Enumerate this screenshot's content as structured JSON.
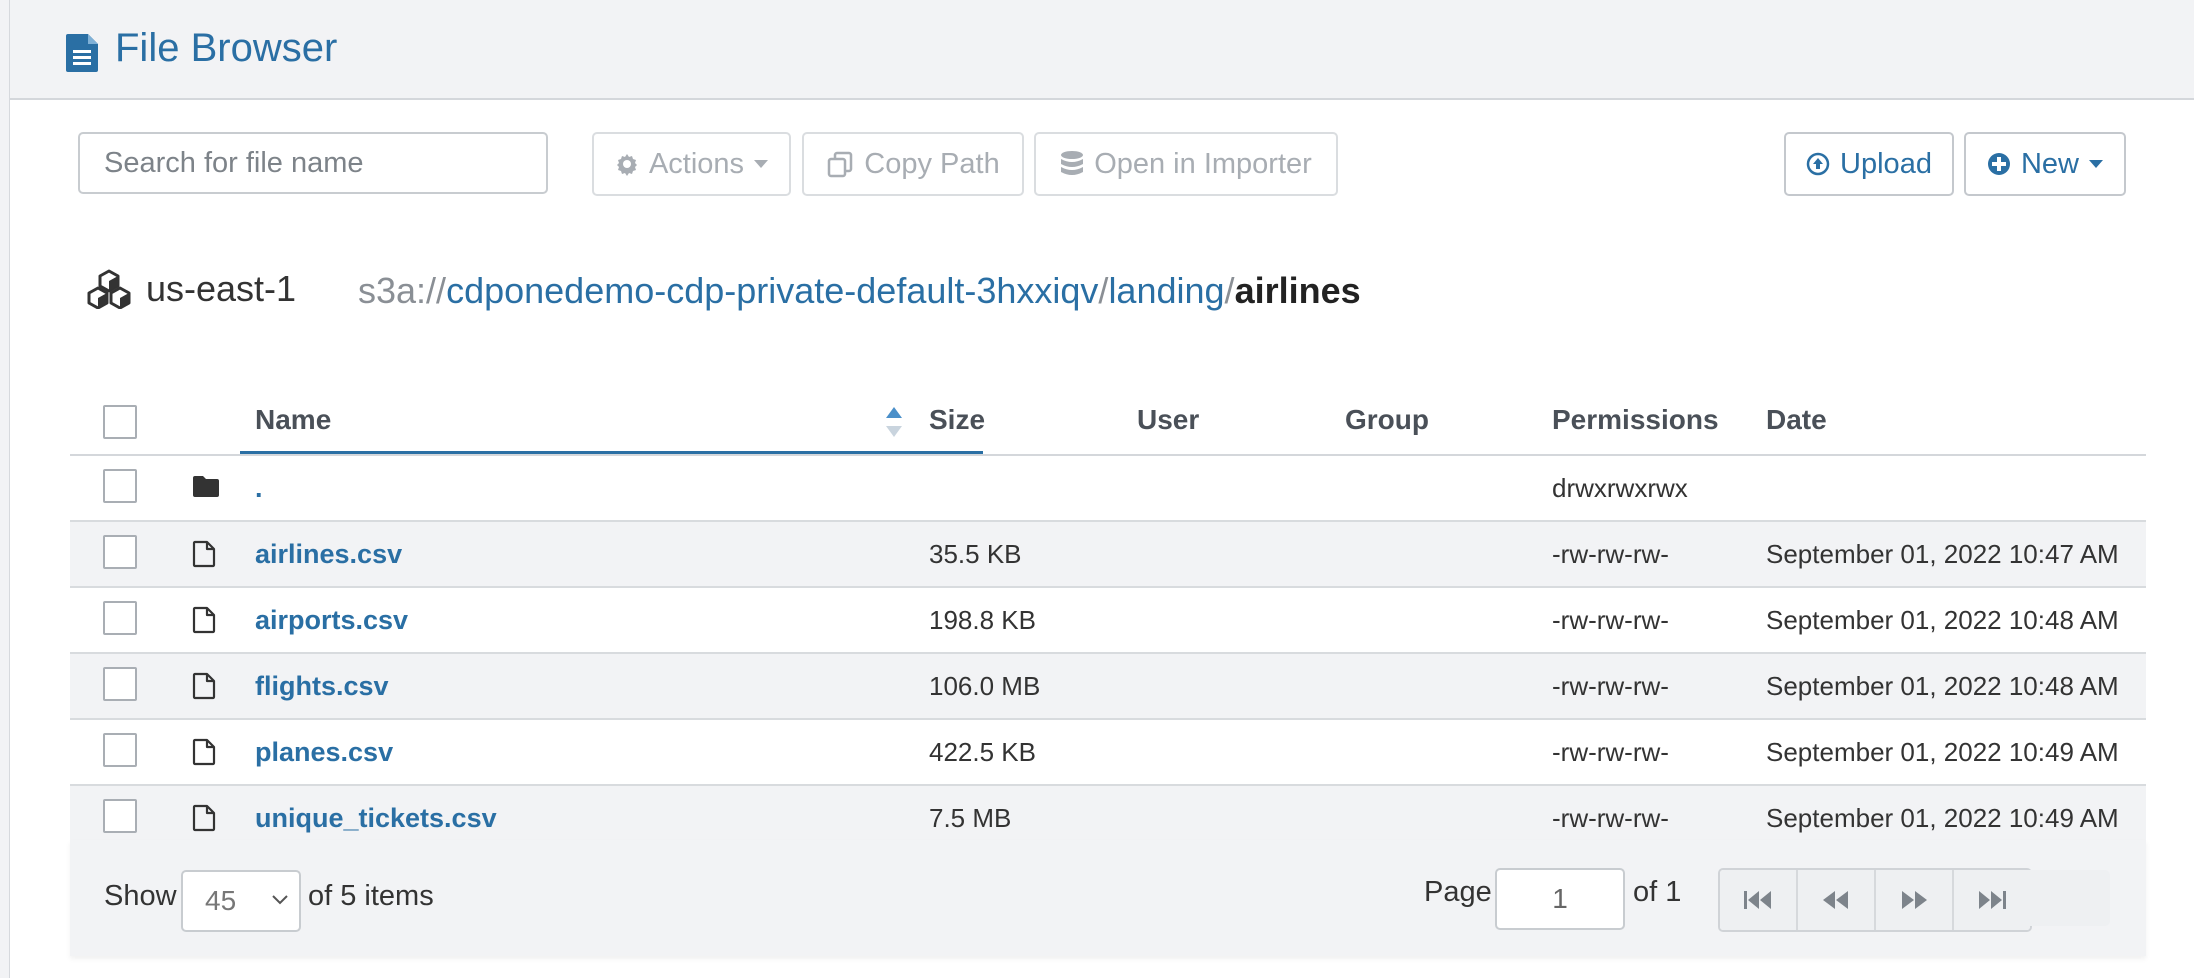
{
  "header": {
    "title": "File Browser",
    "icon": "file-text-icon"
  },
  "toolbar": {
    "search_placeholder": "Search for file name",
    "actions_label": "Actions",
    "copy_path_label": "Copy Path",
    "open_importer_label": "Open in Importer",
    "upload_label": "Upload",
    "new_label": "New"
  },
  "location": {
    "region": "us-east-1",
    "scheme": "s3a://",
    "segments": [
      "cdponedemo-cdp-private-default-3hxxiqv",
      "landing"
    ],
    "separator": "/",
    "current": "airlines"
  },
  "table": {
    "columns": {
      "name": "Name",
      "size": "Size",
      "user": "User",
      "group": "Group",
      "permissions": "Permissions",
      "date": "Date"
    },
    "sorted_by": "Name",
    "rows": [
      {
        "type": "folder",
        "name": ".",
        "size": "",
        "user": "",
        "group": "",
        "permissions": "drwxrwxrwx",
        "date": ""
      },
      {
        "type": "file",
        "name": "airlines.csv",
        "size": "35.5 KB",
        "user": "",
        "group": "",
        "permissions": "-rw-rw-rw-",
        "date": "September 01, 2022 10:47 AM"
      },
      {
        "type": "file",
        "name": "airports.csv",
        "size": "198.8 KB",
        "user": "",
        "group": "",
        "permissions": "-rw-rw-rw-",
        "date": "September 01, 2022 10:48 AM"
      },
      {
        "type": "file",
        "name": "flights.csv",
        "size": "106.0 MB",
        "user": "",
        "group": "",
        "permissions": "-rw-rw-rw-",
        "date": "September 01, 2022 10:48 AM"
      },
      {
        "type": "file",
        "name": "planes.csv",
        "size": "422.5 KB",
        "user": "",
        "group": "",
        "permissions": "-rw-rw-rw-",
        "date": "September 01, 2022 10:49 AM"
      },
      {
        "type": "file",
        "name": "unique_tickets.csv",
        "size": "7.5 MB",
        "user": "",
        "group": "",
        "permissions": "-rw-rw-rw-",
        "date": "September 01, 2022 10:49 AM"
      }
    ]
  },
  "footer": {
    "show_label": "Show",
    "page_size": "45",
    "of_items": "of 5 items",
    "page_label": "Page",
    "page_value": "1",
    "of_pages": "of 1"
  },
  "colors": {
    "accent": "#2a6fa4",
    "header_bg": "#f2f3f5",
    "disabled": "#a8adb3"
  }
}
